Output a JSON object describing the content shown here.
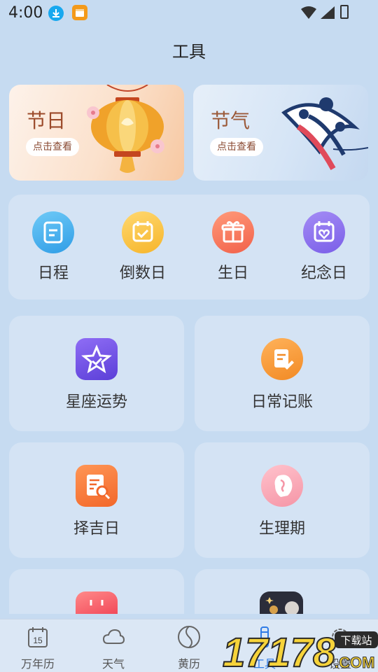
{
  "status": {
    "time": "4:00"
  },
  "page": {
    "title": "工具"
  },
  "banners": [
    {
      "title": "节日",
      "button": "点击查看"
    },
    {
      "title": "节气",
      "button": "点击查看"
    }
  ],
  "quick": [
    {
      "label": "日程"
    },
    {
      "label": "倒数日"
    },
    {
      "label": "生日"
    },
    {
      "label": "纪念日"
    }
  ],
  "tiles": [
    {
      "label": "星座运势"
    },
    {
      "label": "日常记账"
    },
    {
      "label": "择吉日"
    },
    {
      "label": "生理期"
    }
  ],
  "tabs": [
    {
      "label": "万年历",
      "icon_text": "15"
    },
    {
      "label": "天气"
    },
    {
      "label": "黄历"
    },
    {
      "label": "工具"
    },
    {
      "label": "设置"
    }
  ],
  "watermark": {
    "text": "17178",
    "site": "下载站",
    "suffix": ".COM"
  },
  "colors": {
    "background": "#c6dbf1",
    "card": "#d4e3f4",
    "accent": "#2f7be6"
  }
}
